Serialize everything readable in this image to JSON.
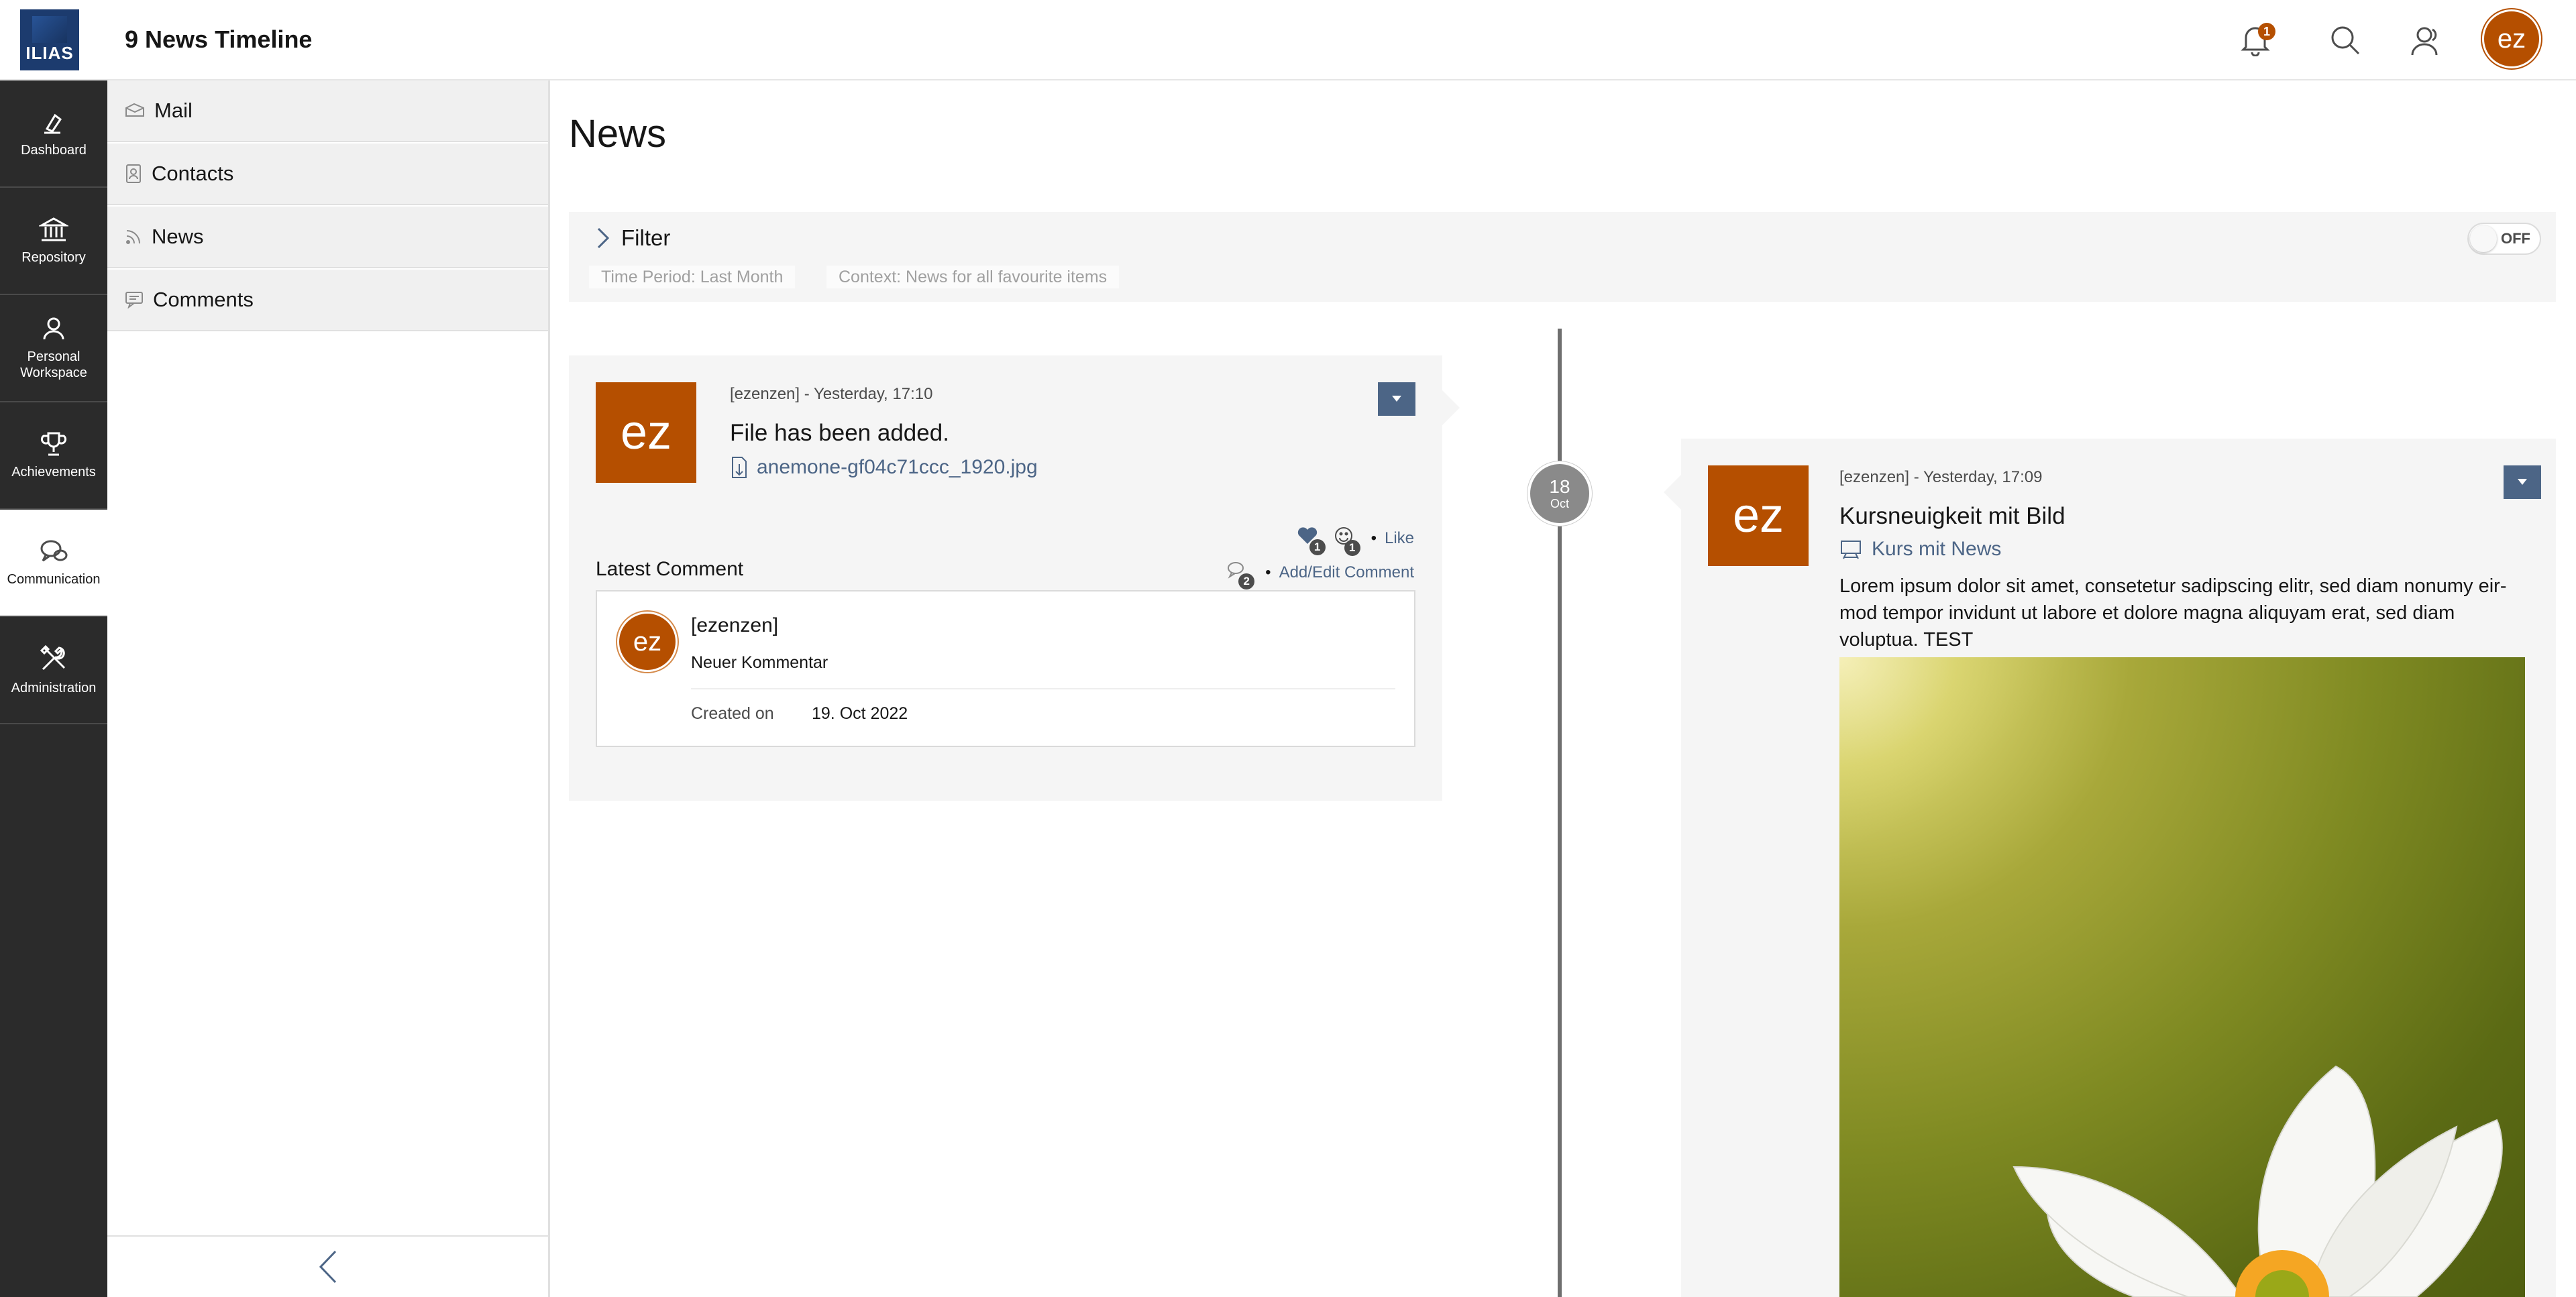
{
  "header": {
    "logo_text": "ILIAS",
    "title": "9 News Timeline",
    "notification_count": "1",
    "avatar_initials": "ez"
  },
  "mainbar": {
    "items": [
      {
        "label": "Dashboard",
        "icon": "dashboard-icon"
      },
      {
        "label": "Repository",
        "icon": "repository-icon"
      },
      {
        "label": "Personal Workspace",
        "icon": "person-icon"
      },
      {
        "label": "Achievements",
        "icon": "trophy-icon"
      },
      {
        "label": "Communication",
        "icon": "chat-icon",
        "active": true
      },
      {
        "label": "Administration",
        "icon": "tools-icon"
      }
    ]
  },
  "slate": {
    "items": [
      {
        "label": "Mail",
        "icon": "mail-icon"
      },
      {
        "label": "Contacts",
        "icon": "contacts-icon"
      },
      {
        "label": "News",
        "icon": "rss-icon"
      },
      {
        "label": "Comments",
        "icon": "comment-icon"
      }
    ]
  },
  "page": {
    "title": "News"
  },
  "filter": {
    "label": "Filter",
    "chips": [
      "Time Period: Last Month",
      "Context: News for all favourite items"
    ],
    "switch_label": "OFF"
  },
  "timeline": {
    "date_day": "18",
    "date_month": "Oct"
  },
  "card1": {
    "avatar": "ez",
    "meta": "[ezenzen] - Yesterday, 17:10",
    "title": "File has been added.",
    "file_link": "anemone-gf04c71ccc_1920.jpg",
    "like_count": "1",
    "smiley_count": "1",
    "like_label": "Like",
    "latest_comment_label": "Latest Comment",
    "comment_count": "2",
    "add_edit_label": "Add/Edit Comment",
    "comment": {
      "avatar": "ez",
      "user": "[ezenzen]",
      "text": "Neuer Kommentar",
      "created_label": "Created on",
      "created_value": "19. Oct 2022"
    }
  },
  "card2": {
    "avatar": "ez",
    "meta": "[ezenzen] - Yesterday, 17:09",
    "title": "Kursneuigkeit mit Bild",
    "course_link": "Kurs mit News",
    "body": "Lorem ipsum dolor sit amet, consetetur sadipscing elitr, sed diam nonumy eir-mod tempor invidunt ut labore et dolore magna aliquyam erat, sed diam voluptua. TEST",
    "image_desc": "white anemone flower on green background"
  },
  "colors": {
    "accent": "#4c6586",
    "avatar": "#b54f00",
    "mainbar": "#2b2b2b"
  }
}
